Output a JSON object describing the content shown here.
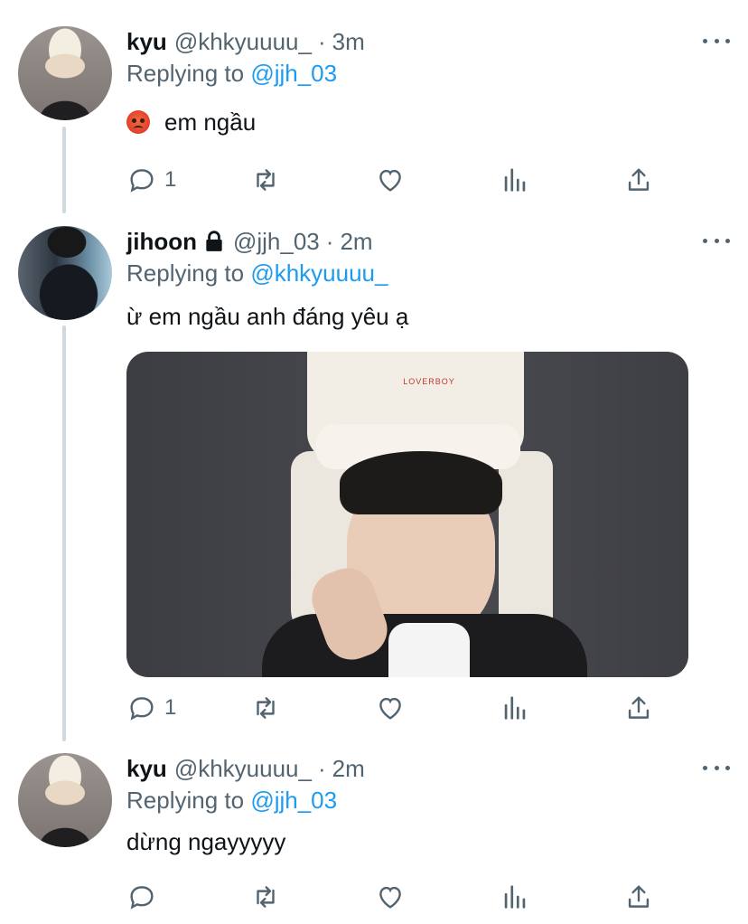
{
  "tweets": [
    {
      "name": "kyu",
      "handle": "@khkyuuuu_",
      "separator": "·",
      "time": "3m",
      "replying_prefix": "Replying to",
      "replying_to": "@jjh_03",
      "text": "em ngầu",
      "has_emoji": "angry-face",
      "reply_count": "1"
    },
    {
      "name": "jihoon",
      "handle": "@jjh_03",
      "separator": "·",
      "time": "2m",
      "replying_prefix": "Replying to",
      "replying_to": "@khkyuuuu_",
      "text": "ừ em ngầu anh đáng yêu ạ",
      "media_label": "LOVERBOY",
      "reply_count": "1"
    },
    {
      "name": "kyu",
      "handle": "@khkyuuuu_",
      "separator": "·",
      "time": "2m",
      "replying_prefix": "Replying to",
      "replying_to": "@jjh_03",
      "text": "dừng ngayyyyy",
      "reply_count": ""
    }
  ],
  "colors": {
    "link": "#1d9bf0",
    "secondary": "#536471",
    "primary": "#0f1419",
    "thread_line": "#cfd9de"
  },
  "icons": [
    "reply-icon",
    "retweet-icon",
    "like-icon",
    "analytics-icon",
    "share-icon",
    "more-icon",
    "lock-icon"
  ]
}
